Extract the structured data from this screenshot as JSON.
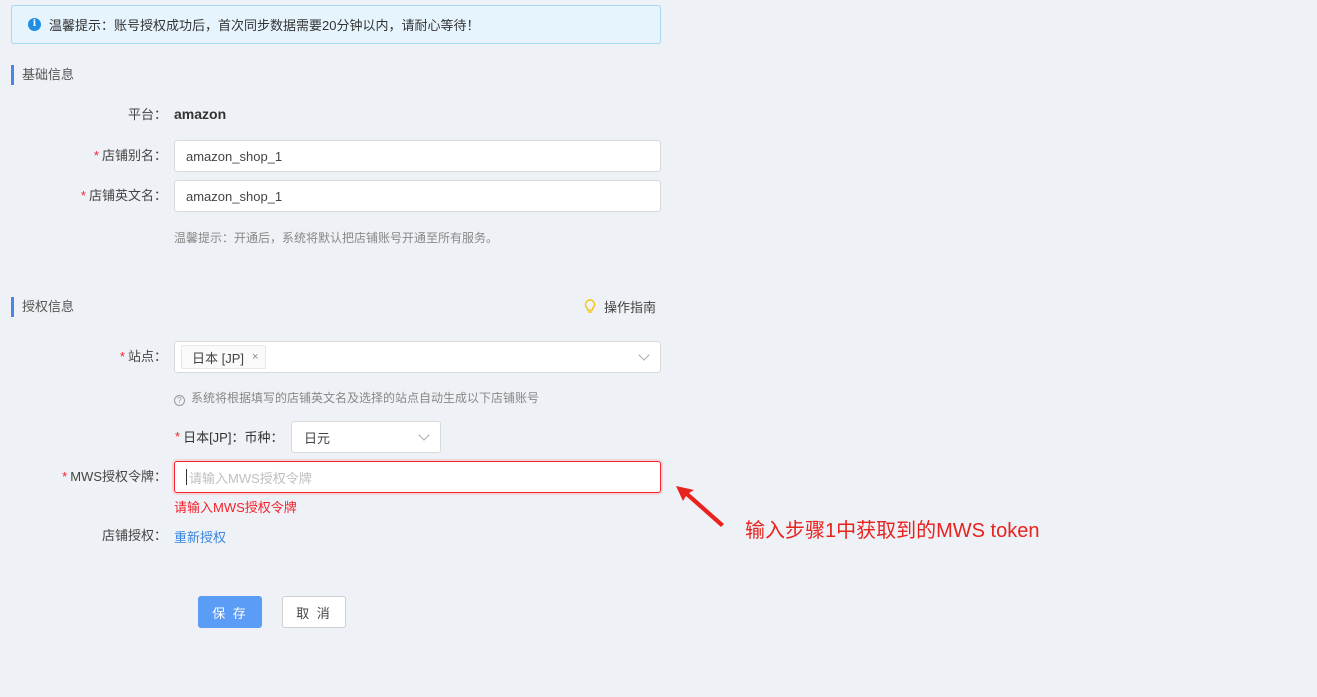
{
  "alert": {
    "text": "温馨提示：账号授权成功后，首次同步数据需要20分钟以内，请耐心等待！",
    "icon": "info-icon"
  },
  "basic_section": {
    "title": "基础信息",
    "platform_label": "平台：",
    "platform_value": "amazon",
    "alias_label": "店铺别名：",
    "alias_value": "amazon_shop_1",
    "en_name_label": "店铺英文名：",
    "en_name_value": "amazon_shop_1",
    "hint": "温馨提示：开通后，系统将默认把店铺账号开通至所有服务。"
  },
  "auth_section": {
    "title": "授权信息",
    "guide_label": "操作指南",
    "site_label": "站点：",
    "site_tag": "日本 [JP]",
    "site_tag_close": "×",
    "site_hint": "系统将根据填写的店铺英文名及选择的站点自动生成以下店铺账号",
    "currency_label": "日本[JP]：币种：",
    "currency_value": "日元",
    "mws_label": "MWS授权令牌：",
    "mws_placeholder": "请输入MWS授权令牌",
    "mws_error": "请输入MWS授权令牌",
    "shop_auth_label": "店铺授权：",
    "reauth_link": "重新授权"
  },
  "actions": {
    "save_label": "保 存",
    "cancel_label": "取 消"
  },
  "annotation": {
    "text": "输入步骤1中获取到的MWS token"
  },
  "colors": {
    "accent": "#4a86e8",
    "primary_button": "#5b9cf7",
    "error": "#f5222d",
    "annotation": "#e8221f"
  }
}
